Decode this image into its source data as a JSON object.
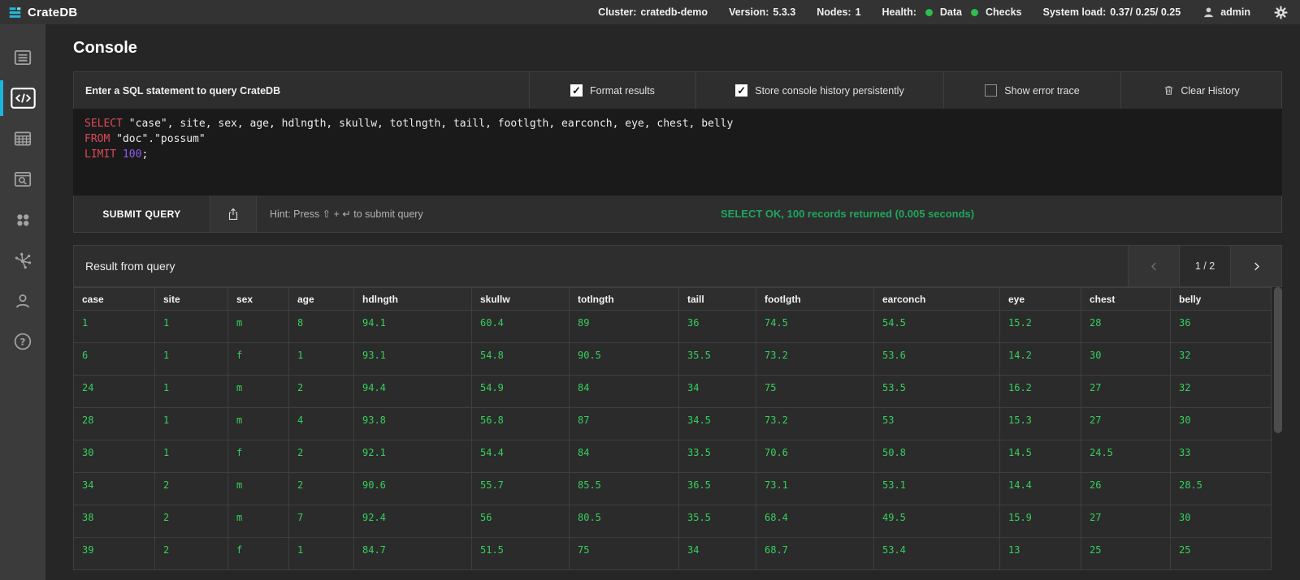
{
  "topbar": {
    "brand": "CrateDB",
    "cluster": {
      "label": "Cluster:",
      "value": "cratedb-demo"
    },
    "version": {
      "label": "Version:",
      "value": "5.3.3"
    },
    "nodes": {
      "label": "Nodes:",
      "value": "1"
    },
    "health": {
      "label": "Health:",
      "items": [
        "Data",
        "Checks"
      ],
      "dot_color": "#2dbe4e"
    },
    "load": {
      "label": "System load:",
      "value": "0.37/ 0.25/ 0.25"
    },
    "user": "admin",
    "icons": [
      "cratedb-logo",
      "user-icon",
      "gear-icon"
    ]
  },
  "sidebar": {
    "accent_color": "#1cb5d9",
    "items": [
      {
        "name": "overview",
        "icon": "overview-icon",
        "active": false
      },
      {
        "name": "console",
        "icon": "console-icon",
        "active": true
      },
      {
        "name": "tables",
        "icon": "tables-icon",
        "active": false
      },
      {
        "name": "browse",
        "icon": "browse-icon",
        "active": false
      },
      {
        "name": "shards",
        "icon": "shards-icon",
        "active": false
      },
      {
        "name": "cluster",
        "icon": "cluster-network-icon",
        "active": false
      },
      {
        "name": "privileges",
        "icon": "user-outline-icon",
        "active": false
      },
      {
        "name": "help",
        "icon": "help-icon",
        "active": false
      }
    ]
  },
  "console": {
    "title": "Console",
    "editor_label": "Enter a SQL statement to query CrateDB",
    "options": [
      {
        "label": "Format results",
        "checked": true
      },
      {
        "label": "Store console history persistently",
        "checked": true
      },
      {
        "label": "Show error trace",
        "checked": false
      }
    ],
    "clear_history": "Clear History",
    "sql_lines": [
      [
        {
          "t": "SELECT",
          "c": "kw"
        },
        {
          "t": " \"case\", site, sex, age, hdlngth, skullw, totlngth, taill, footlgth, earconch, eye, chest, belly",
          "c": "plain"
        }
      ],
      [
        {
          "t": "FROM",
          "c": "kw"
        },
        {
          "t": " \"doc\".\"possum\"",
          "c": "plain"
        }
      ],
      [
        {
          "t": "LIMIT",
          "c": "kw"
        },
        {
          "t": " ",
          "c": "plain"
        },
        {
          "t": "100",
          "c": "num"
        },
        {
          "t": ";",
          "c": "plain"
        }
      ]
    ],
    "keyword_color": "#dd4a56",
    "number_color": "#8a5cf5",
    "submit_label": "SUBMIT QUERY",
    "hint": "Hint: Press ⇧ + ↵ to submit query",
    "status": "SELECT OK, 100 records returned (0.005 seconds)",
    "status_color": "#1fa75c"
  },
  "results": {
    "title": "Result from query",
    "page_indicator": "1 / 2",
    "value_color": "#35d15c",
    "columns": [
      "case",
      "site",
      "sex",
      "age",
      "hdlngth",
      "skullw",
      "totlngth",
      "taill",
      "footlgth",
      "earconch",
      "eye",
      "chest",
      "belly"
    ],
    "rows": [
      [
        "1",
        "1",
        "m",
        "8",
        "94.1",
        "60.4",
        "89",
        "36",
        "74.5",
        "54.5",
        "15.2",
        "28",
        "36"
      ],
      [
        "6",
        "1",
        "f",
        "1",
        "93.1",
        "54.8",
        "90.5",
        "35.5",
        "73.2",
        "53.6",
        "14.2",
        "30",
        "32"
      ],
      [
        "24",
        "1",
        "m",
        "2",
        "94.4",
        "54.9",
        "84",
        "34",
        "75",
        "53.5",
        "16.2",
        "27",
        "32"
      ],
      [
        "28",
        "1",
        "m",
        "4",
        "93.8",
        "56.8",
        "87",
        "34.5",
        "73.2",
        "53",
        "15.3",
        "27",
        "30"
      ],
      [
        "30",
        "1",
        "f",
        "2",
        "92.1",
        "54.4",
        "84",
        "33.5",
        "70.6",
        "50.8",
        "14.5",
        "24.5",
        "33"
      ],
      [
        "34",
        "2",
        "m",
        "2",
        "90.6",
        "55.7",
        "85.5",
        "36.5",
        "73.1",
        "53.1",
        "14.4",
        "26",
        "28.5"
      ],
      [
        "38",
        "2",
        "m",
        "7",
        "92.4",
        "56",
        "80.5",
        "35.5",
        "68.4",
        "49.5",
        "15.9",
        "27",
        "30"
      ],
      [
        "39",
        "2",
        "f",
        "1",
        "84.7",
        "51.5",
        "75",
        "34",
        "68.7",
        "53.4",
        "13",
        "25",
        "25"
      ]
    ]
  }
}
